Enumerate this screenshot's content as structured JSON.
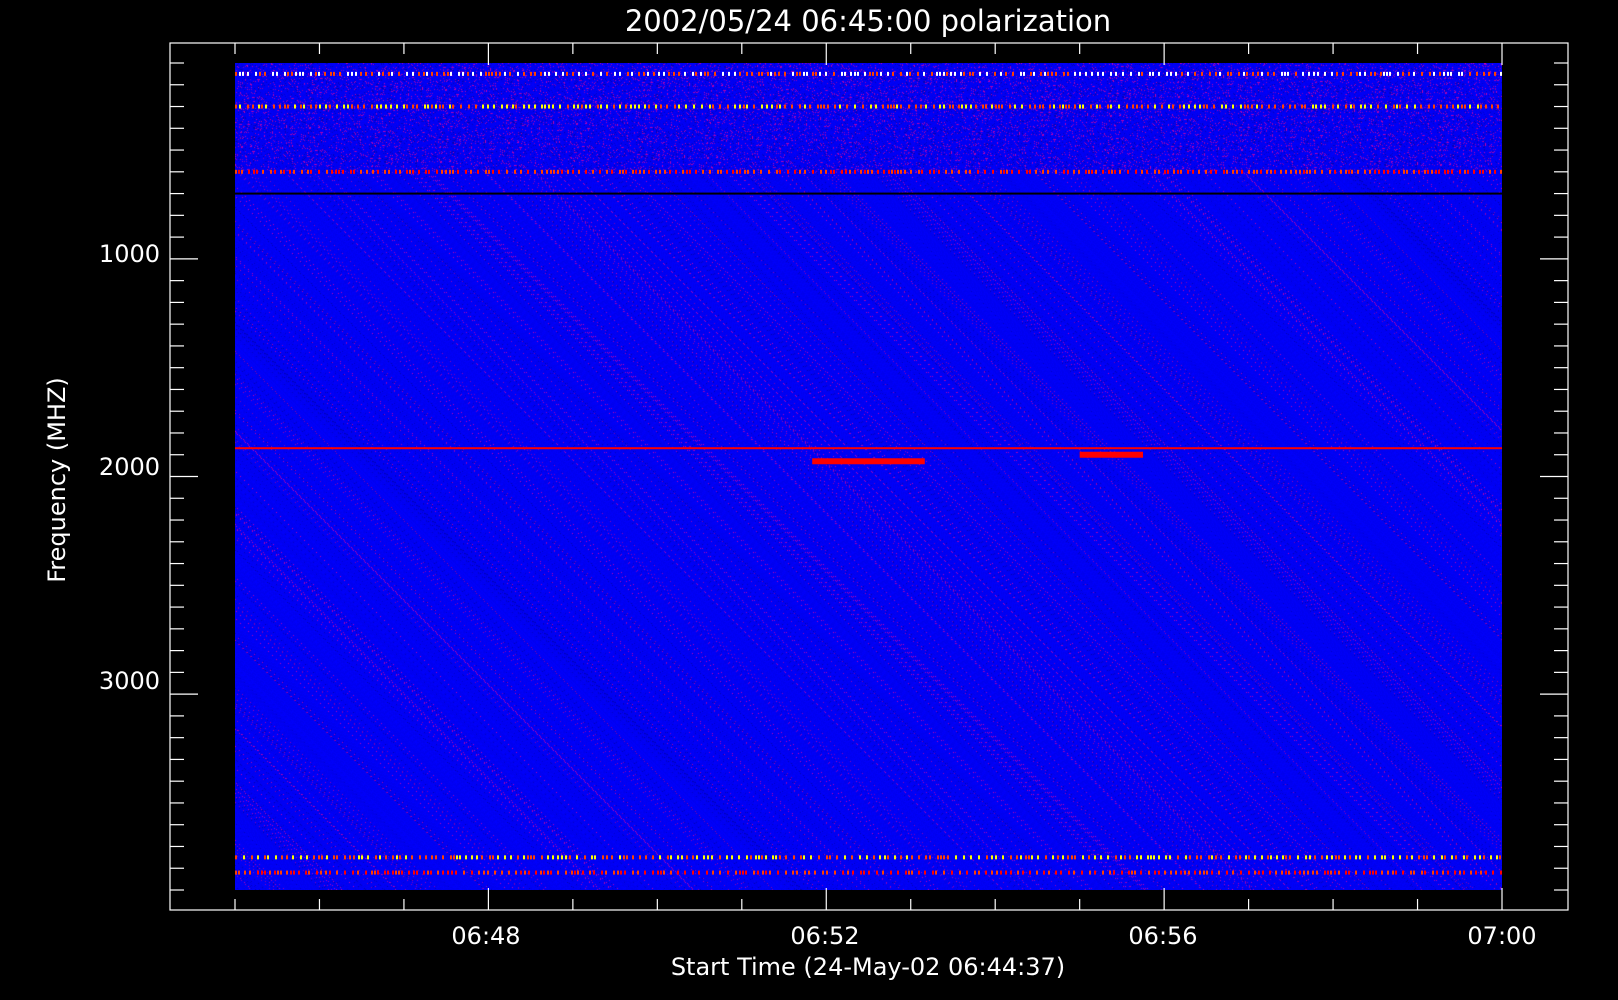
{
  "chart_data": {
    "type": "heatmap",
    "title": "2002/05/24 06:45:00 polarization",
    "xlabel": "Start Time (24-May-02 06:44:37)",
    "ylabel": "Frequency (MHZ)",
    "x_unit": "minutes",
    "xlim": [
      "06:45:00",
      "07:00:00"
    ],
    "ylim": [
      3900,
      100
    ],
    "y_inverted": true,
    "x_tick_labels": [
      "06:48",
      "06:52",
      "06:56",
      "07:00"
    ],
    "x_tick_values": [
      "06:48",
      "06:52",
      "06:56",
      "07:00"
    ],
    "y_tick_labels": [
      "1000",
      "2000",
      "3000"
    ],
    "y_tick_values": [
      1000,
      2000,
      3000
    ],
    "colormap": {
      "low": "#000000",
      "mid": "#0000ff",
      "high": "#ff0000",
      "max": "#ffff00"
    },
    "background_color": "#0000ff",
    "features": [
      {
        "name": "rfi-band",
        "freq_mhz": 150,
        "color": "#ffffff"
      },
      {
        "name": "rfi-band",
        "freq_mhz": 300,
        "color": "#ffff00"
      },
      {
        "name": "rfi-band",
        "freq_mhz": 600,
        "color": "#ff0000"
      },
      {
        "name": "dark-line",
        "freq_mhz": 700,
        "color": "#000000"
      },
      {
        "name": "red-line",
        "freq_mhz": 1870,
        "color": "#ff0000"
      },
      {
        "name": "burst",
        "start": "06:51:50",
        "end": "06:53:10",
        "freq_mhz": 1930,
        "color": "#ff0000"
      },
      {
        "name": "burst",
        "start": "06:55:00",
        "end": "06:55:45",
        "freq_mhz": 1900,
        "color": "#ff0000"
      },
      {
        "name": "rfi-band",
        "freq_mhz": 3750,
        "color": "#ffff00"
      },
      {
        "name": "rfi-band",
        "freq_mhz": 3820,
        "color": "#ff0000"
      }
    ]
  }
}
